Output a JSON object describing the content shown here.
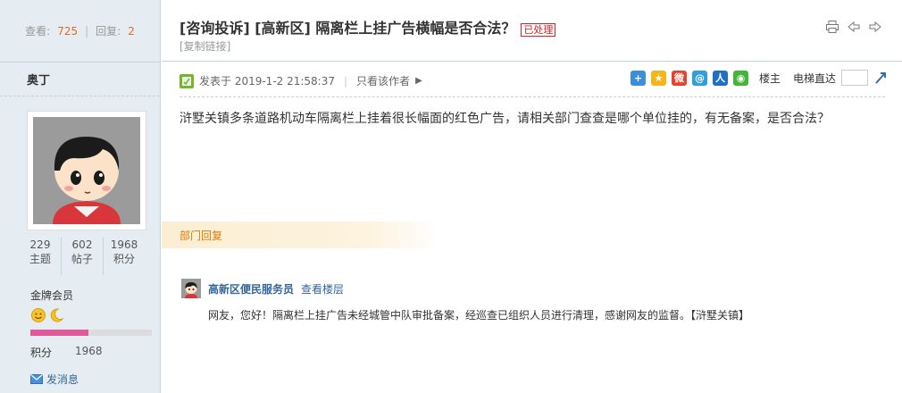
{
  "sidebar": {
    "views_label": "查看:",
    "views_value": "725",
    "replies_label": "回复:",
    "replies_value": "2",
    "author": "奥丁",
    "stats": [
      {
        "num": "229",
        "label": "主题"
      },
      {
        "num": "602",
        "label": "帖子"
      },
      {
        "num": "1968",
        "label": "积分"
      }
    ],
    "level": "金牌会员",
    "level_progress": 0.48,
    "points_label": "积分",
    "points_value": "1968",
    "send_message": "发消息"
  },
  "thread": {
    "title": "[咨询投诉] [高新区] 隔离栏上挂广告横幅是否合法？",
    "status_badge": "已处理",
    "copy_link": "[复制链接]"
  },
  "post": {
    "posted_at": "发表于 2019-1-2 21:58:37",
    "only_author": "只看该作者",
    "floor_label": "楼主",
    "jump_label": "电梯直达",
    "body": "浒墅关镇多条道路机动车隔离栏上挂着很长幅面的红色广告，请相关部门查查是哪个单位挂的，有无备案，是否合法？"
  },
  "reply": {
    "section_label": "部门回复",
    "name": "高新区便民服务员",
    "view_floor": "查看楼层",
    "text": "网友，您好！隔离栏上挂广告未经城管中队审批备案，经巡查已组织人员进行清理，感谢网友的监督。【浒墅关镇】"
  },
  "colors": {
    "accent_link": "#336699",
    "status_red": "#e02020",
    "reply_orange": "#e07b00",
    "level_bar": "#e05a9a"
  }
}
